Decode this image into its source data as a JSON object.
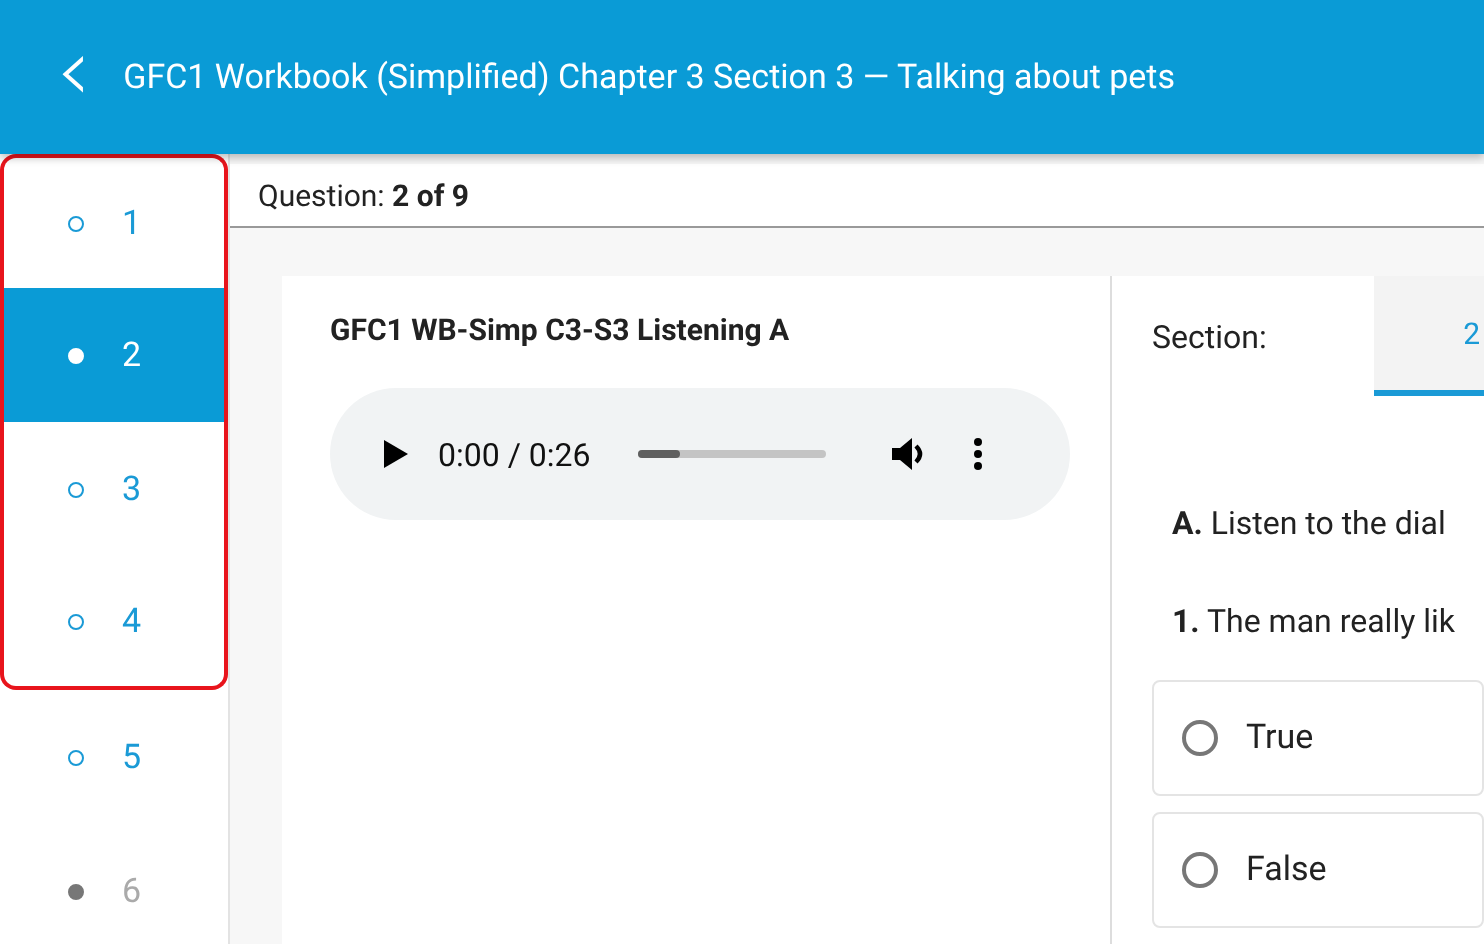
{
  "header": {
    "back": "‹",
    "title": "GFC1 Workbook (Simplified) Chapter 3 Section 3 — Talking about pets"
  },
  "sidebar": {
    "items": [
      {
        "label": "1",
        "selected": false,
        "disabled": false,
        "highlighted": true
      },
      {
        "label": "2",
        "selected": true,
        "disabled": false,
        "highlighted": true
      },
      {
        "label": "3",
        "selected": false,
        "disabled": false,
        "highlighted": true
      },
      {
        "label": "4",
        "selected": false,
        "disabled": false,
        "highlighted": true
      },
      {
        "label": "5",
        "selected": false,
        "disabled": false,
        "highlighted": false
      },
      {
        "label": "6",
        "selected": false,
        "disabled": true,
        "highlighted": false
      }
    ]
  },
  "question_bar": {
    "text": "Question: **2 of 9**"
  },
  "card": {
    "title": "GFC1 WB-Simp C3-S3 Listening A",
    "audio": {
      "time": "0:00 / 0:26",
      "level": 0.22
    }
  },
  "panel": {
    "section_label": "Section:",
    "tabs": [
      {
        "label": "2",
        "selected": true
      }
    ],
    "instruction": "**A.** Listen to the dial",
    "question": "**1.** The man really lik",
    "options": [
      {
        "label": "True",
        "selected": false
      },
      {
        "label": "False",
        "selected": false
      }
    ]
  }
}
